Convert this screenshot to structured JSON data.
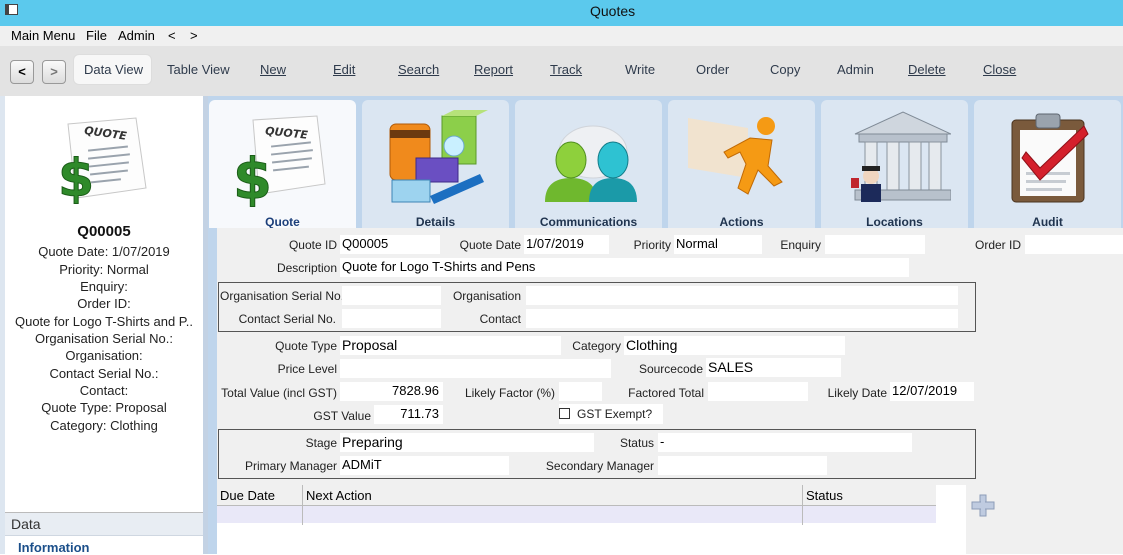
{
  "window": {
    "title": "Quotes"
  },
  "menu": [
    "Main Menu",
    "File",
    "Admin",
    "<",
    ">"
  ],
  "toolbar": {
    "back": "<",
    "forward": ">",
    "data_view": "Data View",
    "table_view": "Table View",
    "new": "New",
    "edit": "Edit",
    "search": "Search",
    "report": "Report",
    "track": "Track",
    "write": "Write",
    "order": "Order",
    "copy": "Copy",
    "admin": "Admin",
    "delete": "Delete",
    "close": "Close"
  },
  "summary": {
    "id": "Q00005",
    "quote_date": "Quote Date: 1/07/2019",
    "priority": "Priority: Normal",
    "enquiry": "Enquiry:",
    "order_id": "Order ID:",
    "description": "Quote for Logo T-Shirts and P..",
    "org_serial": "Organisation Serial No.:",
    "organisation": "Organisation:",
    "contact_serial": "Contact Serial No.:",
    "contact": "Contact:",
    "quote_type": "Quote Type: Proposal",
    "category": "Category: Clothing",
    "data_header": "Data",
    "information": "Information",
    "icon_text": "QUOTE"
  },
  "tabs": [
    "Quote",
    "Details",
    "Communications",
    "Actions",
    "Locations",
    "Audit"
  ],
  "form": {
    "labels": {
      "quote_id": "Quote ID",
      "quote_date": "Quote Date",
      "priority": "Priority",
      "enquiry": "Enquiry",
      "order_id": "Order ID",
      "description": "Description",
      "org_serial": "Organisation Serial No.",
      "organisation": "Organisation",
      "contact_serial": "Contact Serial No.",
      "contact": "Contact",
      "quote_type": "Quote Type",
      "category": "Category",
      "price_level": "Price Level",
      "sourcecode": "Sourcecode",
      "total_value": "Total Value (incl GST)",
      "likely_factor": "Likely Factor (%)",
      "factored_total": "Factored Total",
      "likely_date": "Likely Date",
      "gst_value": "GST Value",
      "gst_exempt": "GST Exempt?",
      "stage": "Stage",
      "status": "Status",
      "primary_manager": "Primary Manager",
      "secondary_manager": "Secondary Manager"
    },
    "values": {
      "quote_id": "Q00005",
      "quote_date": "1/07/2019",
      "priority": "Normal",
      "enquiry": "",
      "order_id": "",
      "description": "Quote for Logo T-Shirts and Pens",
      "org_serial": "",
      "organisation": "",
      "contact_serial": "",
      "contact": "",
      "quote_type": "Proposal",
      "category": "Clothing",
      "price_level": "",
      "sourcecode": "SALES",
      "total_value": "7828.96",
      "likely_factor": "",
      "factored_total": "",
      "likely_date": "12/07/2019",
      "gst_value": "711.73",
      "stage": "Preparing",
      "status": "-",
      "primary_manager": "ADMiT",
      "secondary_manager": ""
    }
  },
  "grid": {
    "columns": [
      "Due Date",
      "Next Action",
      "Status"
    ]
  },
  "colors": {
    "titlebar": "#5bc9ed",
    "tab_area": "#bfd5ec",
    "accent_link": "#1b4f8a"
  }
}
